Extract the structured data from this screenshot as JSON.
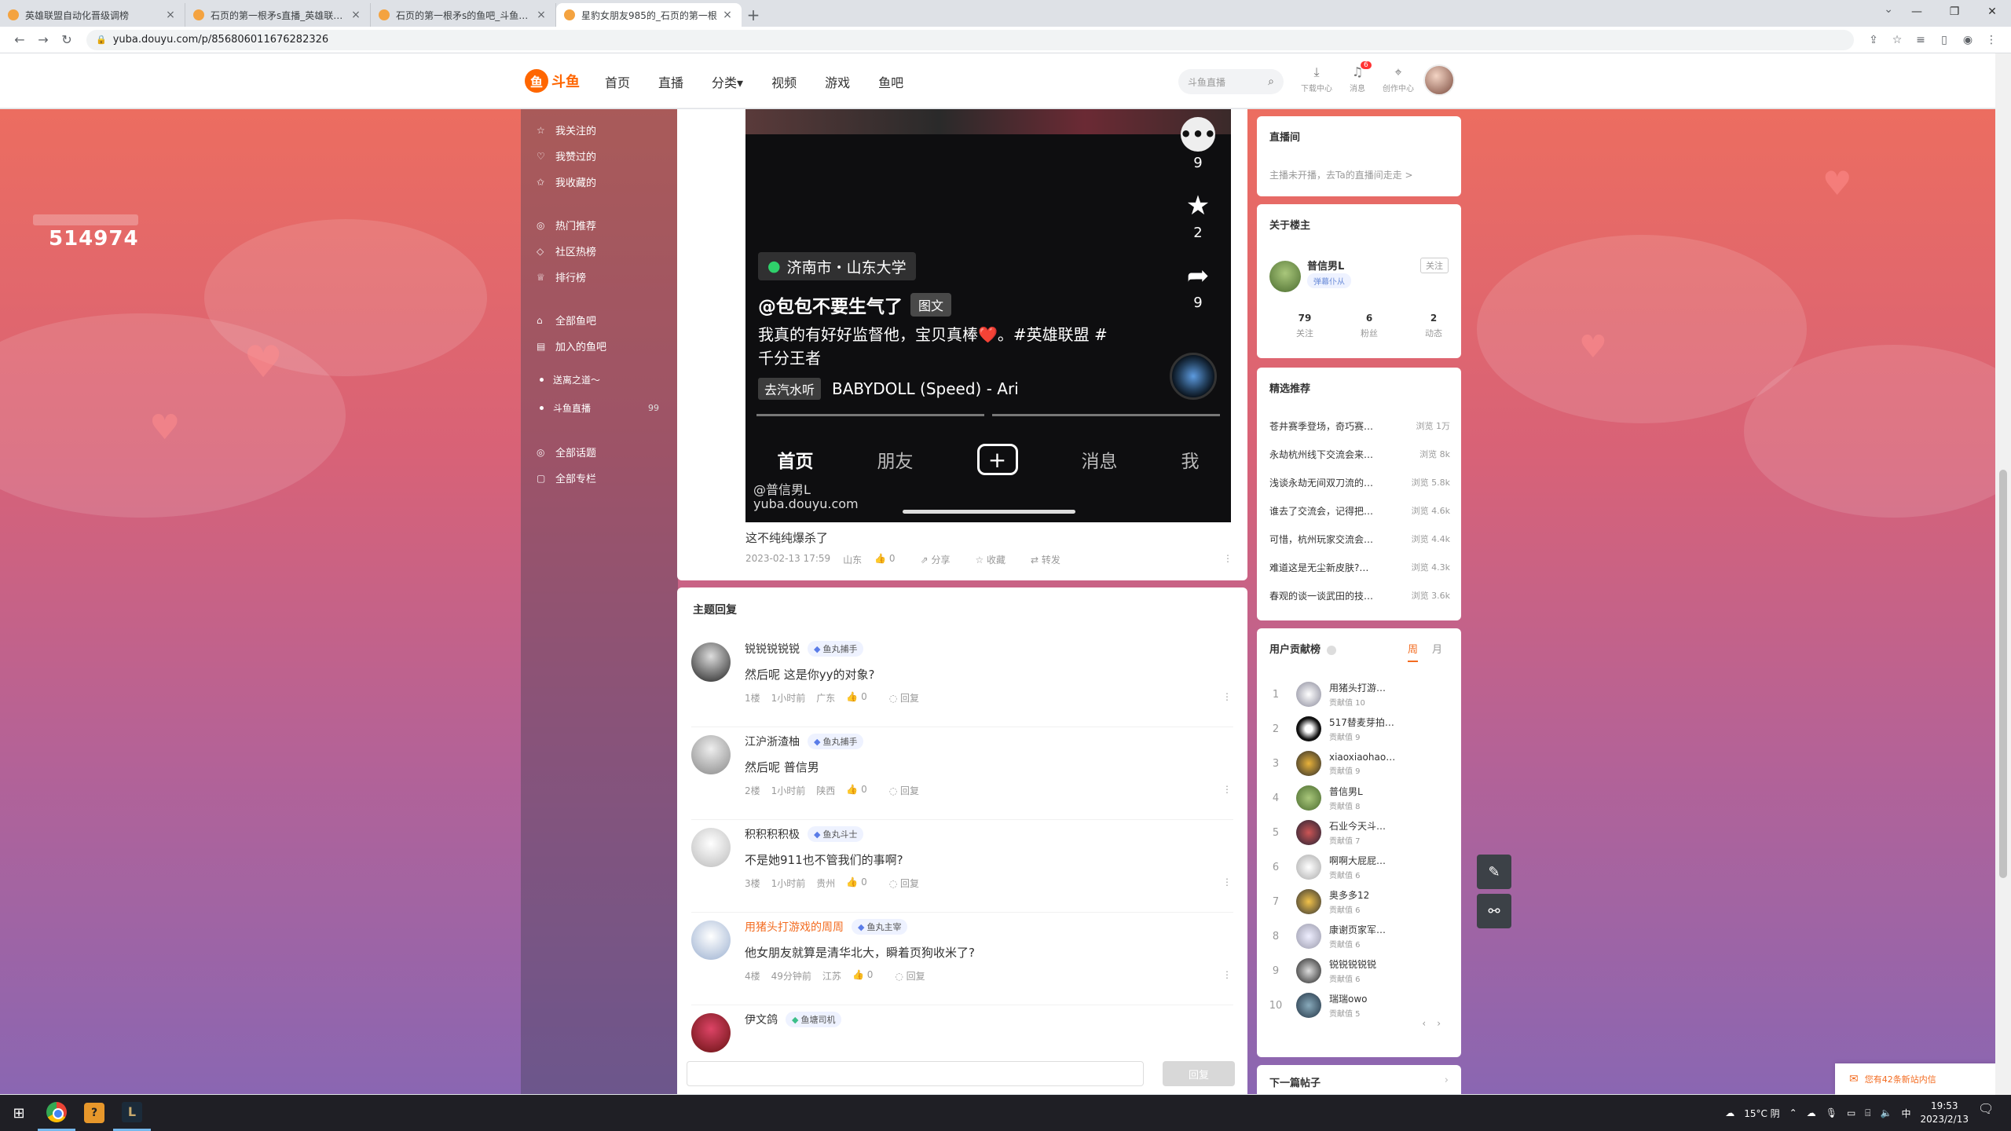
{
  "browser": {
    "tabs": [
      {
        "title": "英雄联盟自动化晋级调榜",
        "active": false
      },
      {
        "title": "石页的第一根矛s直播_英雄联盟直",
        "active": false
      },
      {
        "title": "石页的第一根矛s的鱼吧_斗鱼鱼吧",
        "active": false
      },
      {
        "title": "星豹女朋友985的_石页的第一根",
        "active": true
      }
    ],
    "url": "yuba.douyu.com/p/856806011676282326"
  },
  "header": {
    "logo_text": "斗鱼",
    "nav": [
      "首页",
      "直播",
      "分类▾",
      "视频",
      "游戏",
      "鱼吧"
    ],
    "search_placeholder": "斗鱼直播",
    "icons": [
      {
        "label": "下载中心",
        "icon": "download-icon"
      },
      {
        "label": "消息",
        "icon": "bell-icon",
        "badge": "6"
      },
      {
        "label": "创作中心",
        "icon": "location-pin-icon"
      }
    ]
  },
  "left_panel": {
    "number": "514974"
  },
  "sidebar": {
    "group1": [
      {
        "label": "我关注的",
        "icon": "star-icon"
      },
      {
        "label": "我赞过的",
        "icon": "thumb-icon"
      },
      {
        "label": "我收藏的",
        "icon": "bookmark-icon"
      }
    ],
    "group2": [
      {
        "label": "热门推荐",
        "icon": "fire-icon"
      },
      {
        "label": "社区热榜",
        "icon": "chart-icon"
      },
      {
        "label": "排行榜",
        "icon": "trophy-icon"
      }
    ],
    "group3": [
      {
        "label": "全部鱼吧",
        "icon": "grid-icon"
      },
      {
        "label": "加入的鱼吧",
        "icon": "list-icon"
      }
    ],
    "subs": [
      {
        "label": "送离之道〜",
        "count": ""
      },
      {
        "label": "斗鱼直播",
        "count": "99"
      }
    ],
    "group4": [
      {
        "label": "全部话题",
        "icon": "hash-icon"
      },
      {
        "label": "全部专栏",
        "icon": "doc-icon"
      }
    ]
  },
  "post": {
    "video": {
      "counts": {
        "comments": "9",
        "stars": "2",
        "shares": "9"
      },
      "location": "济南市・山东大学",
      "title": "@包包不要生气了",
      "title_tag": "图文",
      "desc": "我真的有好好监督他，宝贝真棒❤️。#英雄联盟 #千分王者",
      "music_tag": "去汽水听",
      "music": "BABYDOLL (Speed) - Ari",
      "tabs": [
        "首页",
        "朋友",
        "+",
        "消息",
        "我"
      ],
      "watermark_user": "@普信男L",
      "watermark_site": "yuba.douyu.com"
    },
    "text": "这不纯纯爆杀了",
    "meta": {
      "time": "2023-02-13 17:59",
      "region": "山东",
      "likes": "0",
      "share": "分享",
      "collect": "收藏",
      "forward": "转发"
    }
  },
  "replies": {
    "title": "主题回复",
    "items": [
      {
        "name": "锐锐锐锐锐",
        "badge": "鱼丸捕手",
        "text": "然后呢 这是你yy的对象?",
        "floor": "1楼",
        "time": "1小时前",
        "region": "广东",
        "likes": "0",
        "reply": "回复",
        "highlight": false
      },
      {
        "name": "江沪浙渣柚",
        "badge": "鱼丸捕手",
        "text": "然后呢 普信男",
        "floor": "2楼",
        "time": "1小时前",
        "region": "陕西",
        "likes": "0",
        "reply": "回复",
        "highlight": false
      },
      {
        "name": "积积积积极",
        "badge": "鱼丸斗士",
        "text": "不是她911也不管我们的事啊?",
        "floor": "3楼",
        "time": "1小时前",
        "region": "贵州",
        "likes": "0",
        "reply": "回复",
        "highlight": false
      },
      {
        "name": "用猪头打游戏的周周",
        "badge": "鱼丸主宰",
        "text": "他女朋友就算是清华北大，瞬着页狗收米了?",
        "floor": "4楼",
        "time": "49分钟前",
        "region": "江苏",
        "likes": "0",
        "reply": "回复",
        "highlight": true
      },
      {
        "name": "伊文鸽",
        "badge": "鱼塘司机",
        "text": "",
        "floor": "",
        "time": "",
        "region": "",
        "likes": "",
        "reply": "",
        "highlight": false
      }
    ],
    "reply_button": "回复"
  },
  "right": {
    "live": {
      "title": "直播间",
      "tip": "主播未开播，去Ta的直播间走走 >"
    },
    "about": {
      "title": "关于楼主",
      "name": "普信男L",
      "badge": "弹幕仆从",
      "follow": "关注",
      "stats": [
        {
          "value": "79",
          "label": "关注"
        },
        {
          "value": "6",
          "label": "粉丝"
        },
        {
          "value": "2",
          "label": "动态"
        }
      ]
    },
    "picks": {
      "title": "精选推荐",
      "items": [
        {
          "title": "苍井赛季登场，奇巧赛…",
          "views": "浏览 1万"
        },
        {
          "title": "永劫杭州线下交流会来…",
          "views": "浏览 8k"
        },
        {
          "title": "浅谈永劫无间双刀流的…",
          "views": "浏览 5.8k"
        },
        {
          "title": "谁去了交流会，记得把…",
          "views": "浏览 4.6k"
        },
        {
          "title": "可惜，杭州玩家交流会…",
          "views": "浏览 4.4k"
        },
        {
          "title": "难道这是无尘新皮肤?…",
          "views": "浏览 4.3k"
        },
        {
          "title": "春观的谈一谈武田的技…",
          "views": "浏览 3.6k"
        }
      ]
    },
    "contrib": {
      "title": "用户贡献榜",
      "tab_week": "周",
      "tab_month": "月",
      "items": [
        {
          "rank": "1",
          "name": "用猪头打游…",
          "value": "贡献值 10"
        },
        {
          "rank": "2",
          "name": "517替麦芽拍…",
          "value": "贡献值 9"
        },
        {
          "rank": "3",
          "name": "xiaoxiaohao…",
          "value": "贡献值 9"
        },
        {
          "rank": "4",
          "name": "普信男L",
          "value": "贡献值 8"
        },
        {
          "rank": "5",
          "name": "石业今天斗…",
          "value": "贡献值 7"
        },
        {
          "rank": "6",
          "name": "啊啊大屁屁…",
          "value": "贡献值 6"
        },
        {
          "rank": "7",
          "name": "奥多多12",
          "value": "贡献值 6"
        },
        {
          "rank": "8",
          "name": "康谢页家军…",
          "value": "贡献值 6"
        },
        {
          "rank": "9",
          "name": "锐锐锐锐锐",
          "value": "贡献值 6"
        },
        {
          "rank": "10",
          "name": "瑞瑞owo",
          "value": "贡献值 5"
        }
      ],
      "prev": "‹",
      "next": "›"
    },
    "next_post": "下一篇帖子"
  },
  "notice": "您有42条新站内信",
  "taskbar": {
    "weather": "15°C 阴",
    "ime": "中",
    "time": "19:53",
    "date": "2023/2/13"
  }
}
